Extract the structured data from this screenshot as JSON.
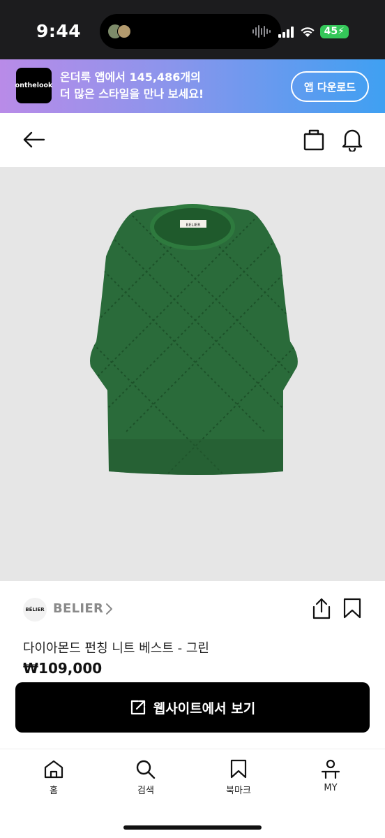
{
  "status_bar": {
    "time": "9:44",
    "battery": "45"
  },
  "promo": {
    "logo_text": "onthelook",
    "line1": "온더룩 앱에서 145,486개의",
    "line2": "더 많은 스타일을 만나 보세요!",
    "button_label": "앱 다운로드"
  },
  "header": {
    "icons": [
      "back-arrow-icon",
      "shopping-bag-icon",
      "bell-icon"
    ]
  },
  "product": {
    "image_tag_text": "BELIER",
    "brand_logo_text": "BÉLIER",
    "brand_name": "BELIER",
    "title": "다이아몬드 펀칭 니트 베스트 - 그린",
    "price": "₩109,000",
    "cta_label": "웹사이트에서 보기",
    "garment_color": "#2a6b3a"
  },
  "tabbar": {
    "items": [
      {
        "label": "홈",
        "icon": "home-icon"
      },
      {
        "label": "검색",
        "icon": "search-icon"
      },
      {
        "label": "북마크",
        "icon": "bookmark-icon"
      },
      {
        "label": "MY",
        "icon": "user-icon"
      }
    ]
  },
  "colors": {
    "accent": "#000000",
    "promo_start": "#b98be8",
    "promo_end": "#3fa0f2"
  }
}
